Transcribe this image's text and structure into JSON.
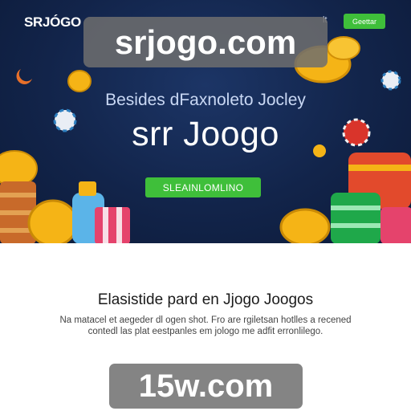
{
  "nav": {
    "logo": "SRJÓGO",
    "link": "lt",
    "button": "Geettar"
  },
  "hero": {
    "subtitle": "Besides dFaxnoleto Jocley",
    "title": "srr Joogo",
    "cta": "SLEAINLOMLINO"
  },
  "content": {
    "heading": "Elasistide pard en Jjogo Joogos",
    "text": "Na matacel et aegeder dl ogen shot. Fro are rgiletsan hotlles a recened contedl las plat eestpanles em jologo me adfit erronlilego."
  },
  "watermarks": {
    "top": "srjogo.com",
    "bottom": "15w.com"
  },
  "colors": {
    "hero_bg": "#12244a",
    "accent": "#3fbf3a",
    "coin": "#f5b416",
    "chip_red": "#d9342b",
    "chip_green": "#1fa84a"
  }
}
